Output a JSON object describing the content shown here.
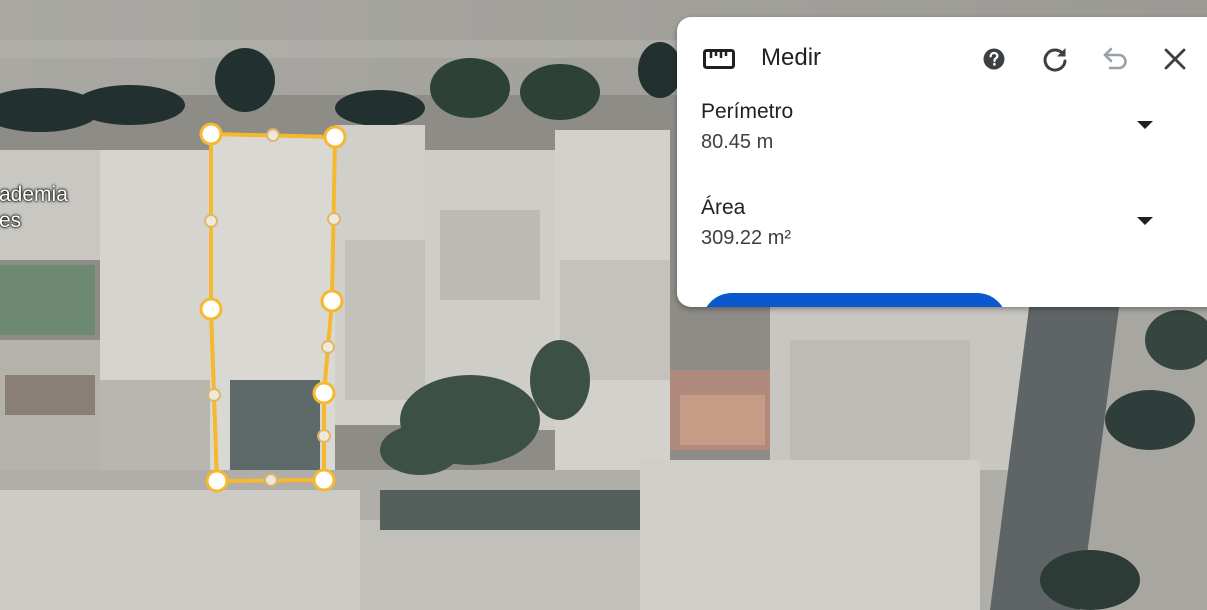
{
  "map": {
    "place_label": "ademia\nes",
    "measurement_color": "#f5b82e",
    "vertex_color": "#ffffff"
  },
  "panel": {
    "title": "Medir",
    "icons": {
      "ruler": "ruler-icon",
      "help": "help-icon",
      "reset": "refresh-icon",
      "undo": "undo-icon",
      "close": "close-icon"
    },
    "perimeter": {
      "label": "Perímetro",
      "value": "80.45 m"
    },
    "area": {
      "label": "Área",
      "value": "309.22 m²"
    }
  }
}
